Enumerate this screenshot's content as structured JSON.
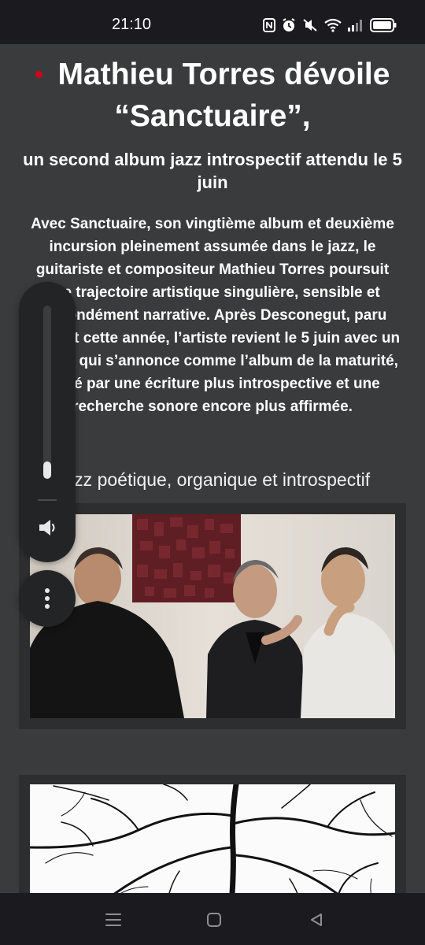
{
  "status_bar": {
    "time": "21:10",
    "icons": [
      "nfc-icon",
      "alarm-icon",
      "mute-icon",
      "wifi-icon",
      "signal-icon",
      "battery-icon"
    ]
  },
  "article": {
    "title": "Mathieu Torres dévoile “Sanctuaire”,",
    "subtitle": "un second album jazz introspectif attendu le 5 juin",
    "lede": "Avec Sanctuaire, son vingtième album et deuxième incursion pleinement assumée dans le jazz, le guitariste et compositeur Mathieu Torres poursuit une trajectoire artistique singulière, sensible et profondément narrative. Après Desconegut, paru plus tôt cette année, l’artiste revient le 5 juin avec un disque qui s’annonce comme l’album de la maturité, porté par une écriture plus introspective et une recherche sonore encore plus affirmée.",
    "genre_heading": "Jazz poétique, organique et introspectif"
  },
  "volume": {
    "level": 0.1
  },
  "colors": {
    "background": "#3a3b3c",
    "bars": "#1b1b1f",
    "accent_dot": "#d0021b",
    "overlay": "#232425"
  }
}
